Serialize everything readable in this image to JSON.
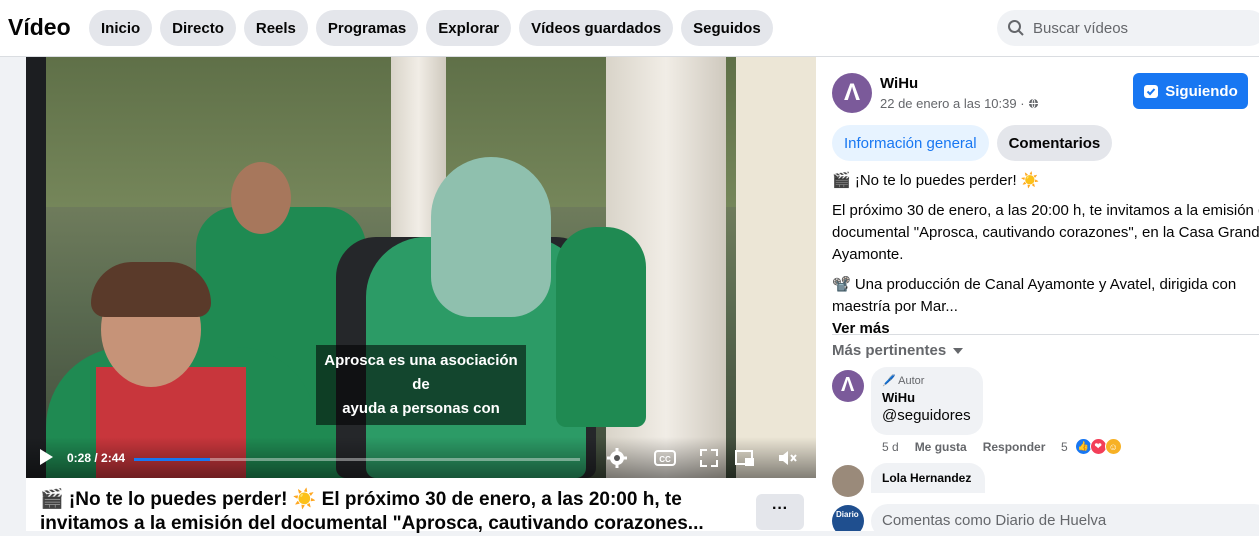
{
  "header": {
    "title": "Vídeo",
    "nav": [
      "Inicio",
      "Directo",
      "Reels",
      "Programas",
      "Explorar",
      "Vídeos guardados",
      "Seguidos"
    ],
    "search_placeholder": "Buscar vídeos"
  },
  "video": {
    "subtitle_line1": "Aprosca es una asociación de",
    "subtitle_line2": "ayuda a personas con",
    "time": "0:28 / 2:44",
    "progress": 0.17,
    "caption_line1": "🎬 ¡No te lo puedes perder! ☀️ El próximo 30 de enero, a las 20:00 h, te",
    "caption_line2": "invitamos a la emisión del documental \"Aprosca, cautivando corazones...",
    "more_label": "···"
  },
  "post": {
    "page_name": "WiHu",
    "date": "22 de enero a las 10:39 ·",
    "follow_label": "Siguiendo",
    "tabs": [
      "Información general",
      "Comentarios"
    ],
    "desc_line1": "🎬 ¡No te lo puedes perder! ☀️",
    "desc_line2a": "El próximo 30 de enero, a las 20:00 h, te invitamos a la emisión del",
    "desc_line2b": "documental \"Aprosca, cautivando corazones\", en la Casa Grande de",
    "desc_line2c": "Ayamonte.",
    "desc_line3a": "📽️ Una producción de Canal Ayamonte y Avatel, dirigida con",
    "desc_line3b": "maestría por Mar...",
    "ver_mas": "Ver más",
    "sort_label": "Más pertinentes"
  },
  "comments": [
    {
      "badge": "🖊️ Autor",
      "name": "WiHu",
      "text": "@seguidores",
      "age": "5 d",
      "like": "Me gusta",
      "reply": "Responder",
      "reaction_count": "5"
    },
    {
      "name": "Lola Hernandez"
    }
  ],
  "composer": {
    "placeholder": "Comentas como Diario de Huelva"
  }
}
